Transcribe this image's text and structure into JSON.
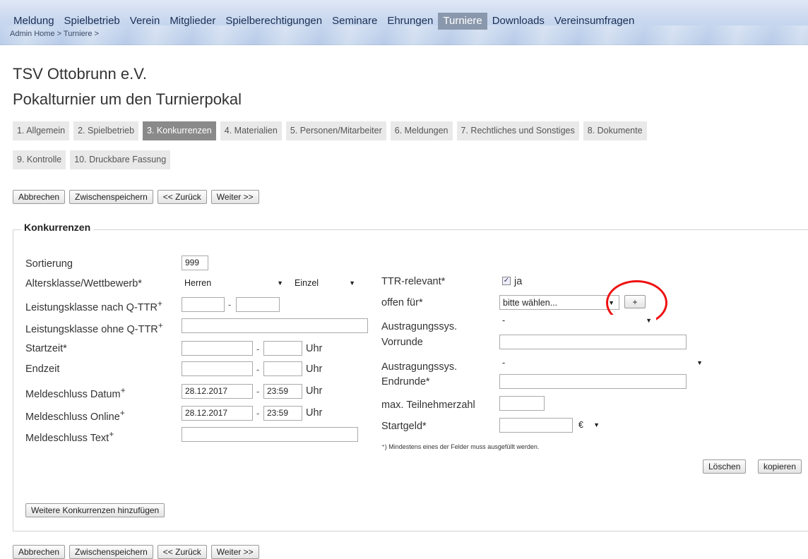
{
  "nav": {
    "items": [
      "Meldung",
      "Spielbetrieb",
      "Verein",
      "Mitglieder",
      "Spielberechtigungen",
      "Seminare",
      "Ehrungen",
      "Turniere",
      "Downloads",
      "Vereinsumfragen"
    ],
    "active_index": 7,
    "breadcrumb": "Admin Home > Turniere >"
  },
  "header": {
    "club": "TSV Ottobrunn e.V.",
    "tournament": "Pokalturnier um den Turnierpokal"
  },
  "steps": {
    "row1": [
      "1. Allgemein",
      "2. Spielbetrieb",
      "3. Konkurrenzen",
      "4. Materialien",
      "5. Personen/Mitarbeiter",
      "6. Meldungen",
      "7. Rechtliches und Sonstiges",
      "8. Dokumente"
    ],
    "row2": [
      "9. Kontrolle",
      "10. Druckbare Fassung"
    ],
    "active": "3. Konkurrenzen"
  },
  "buttons": {
    "cancel": "Abbrechen",
    "save": "Zwischenspeichern",
    "back": "<< Zurück",
    "next": "Weiter >>",
    "delete": "Löschen",
    "copy": "kopieren",
    "add_more": "Weitere Konkurrenzen hinzufügen",
    "plus": "+"
  },
  "form": {
    "legend": "Konkurrenzen",
    "sortierung_label": "Sortierung",
    "sortierung_value": "999",
    "altersklasse_label": "Altersklasse/Wettbewerb*",
    "altersklasse_value": "Herren",
    "wettbewerb_value": "Einzel",
    "lk_qttr_label": "Leistungsklasse nach Q-TTR",
    "lk_ohne_label": "Leistungsklasse ohne Q-TTR",
    "startzeit_label": "Startzeit*",
    "endzeit_label": "Endzeit",
    "uhr": "Uhr",
    "meldeschluss_datum_label": "Meldeschluss Datum",
    "meldeschluss_datum_value": "28.12.2017",
    "meldeschluss_datum_time": "23:59",
    "meldeschluss_online_label": "Meldeschluss Online",
    "meldeschluss_online_value": "28.12.2017",
    "meldeschluss_online_time": "23:59",
    "meldeschluss_text_label": "Meldeschluss Text",
    "plus_mark": "+",
    "ttr_label": "TTR-relevant*",
    "ttr_value": "ja",
    "offen_label": "offen für*",
    "offen_value": "bitte wählen...",
    "aus_vor_label1": "Austragungssys.",
    "aus_vor_label2": "Vorrunde",
    "aus_vor_value": "-",
    "aus_end_label1": "Austragungssys.",
    "aus_end_label2": "Endrunde*",
    "aus_end_value": "-",
    "max_label": "max. Teilnehmerzahl",
    "startgeld_label": "Startgeld*",
    "currency": "€",
    "footnote": "⁺) Mindestens eines der Felder muss ausgefüllt werden."
  },
  "colors": {
    "highlight_circle": "#ee1111",
    "active_tab": "#8a98ad"
  }
}
